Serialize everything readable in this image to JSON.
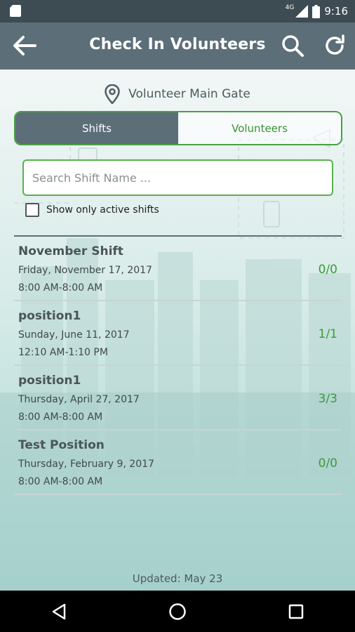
{
  "status_bar": {
    "time": "9:16",
    "network": "4G",
    "icons": [
      "sd-card-icon",
      "signal-icon",
      "battery-icon"
    ]
  },
  "app_bar": {
    "title": "Check In Volunteers",
    "icons": [
      "back-arrow-icon",
      "search-icon",
      "refresh-icon"
    ]
  },
  "location": {
    "label": "Volunteer Main Gate",
    "icon": "location-pin-icon"
  },
  "tabs": [
    {
      "label": "Shifts",
      "active": true
    },
    {
      "label": "Volunteers",
      "active": false
    }
  ],
  "search": {
    "placeholder": "Search Shift Name ...",
    "value": ""
  },
  "filter": {
    "label": "Show only active shifts",
    "checked": false
  },
  "shifts": [
    {
      "name": "November Shift",
      "date": "Friday, November 17, 2017",
      "time": "8:00 AM-8:00 AM",
      "count": "0/0"
    },
    {
      "name": "position1",
      "date": "Sunday, June 11, 2017",
      "time": "12:10 AM-1:10 PM",
      "count": "1/1"
    },
    {
      "name": "position1",
      "date": "Thursday, April 27, 2017",
      "time": "8:00 AM-8:00 AM",
      "count": "3/3"
    },
    {
      "name": "Test Position",
      "date": "Thursday, February 9, 2017",
      "time": "8:00 AM-8:00 AM",
      "count": "0/0"
    }
  ],
  "footer": {
    "updated": "Updated: May 23"
  },
  "colors": {
    "app_bar": "#5c6e78",
    "status_bar": "#3d4b53",
    "accent_green": "#4aa043",
    "count_green": "#3d9a39",
    "background_bottom": "#a8d5d0"
  }
}
